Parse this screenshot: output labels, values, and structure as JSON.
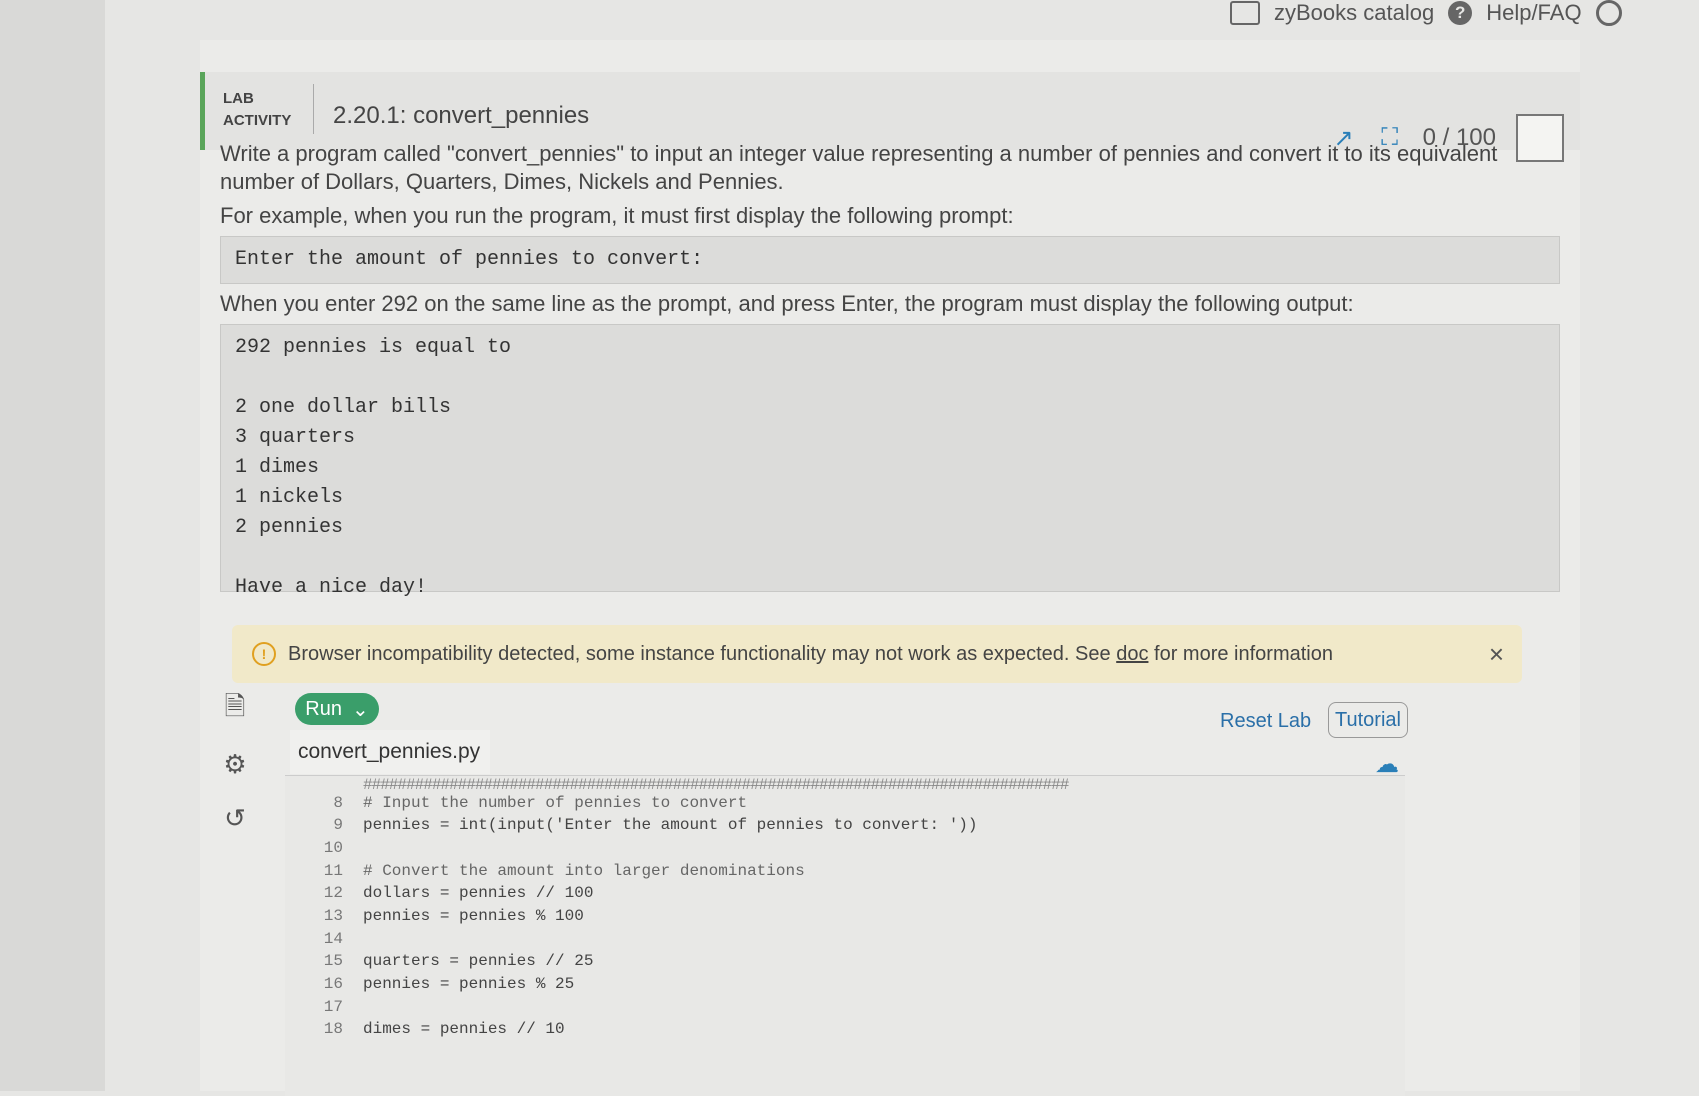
{
  "topbar": {
    "catalog": "zyBooks catalog",
    "help": "Help/FAQ"
  },
  "header": {
    "lab_line1": "LAB",
    "lab_line2": "ACTIVITY",
    "title": "2.20.1: convert_pennies",
    "score": "0 / 100"
  },
  "prompt": {
    "p1": "Write a program called \"convert_pennies\" to input an integer value representing a number of pennies and convert it to its equivalent number of Dollars, Quarters, Dimes, Nickels and Pennies.",
    "p2": "For example, when you run the program, it must first display the following prompt:",
    "prompt_code": "Enter the amount of pennies to convert:",
    "p3": "When you enter 292 on the same line as the prompt, and press Enter, the program must display the following output:",
    "output_code": "292 pennies is equal to\n\n2 one dollar bills\n3 quarters\n1 dimes\n1 nickels\n2 pennies\n\nHave a nice day!"
  },
  "warning": {
    "text": "Browser incompatibility detected, some instance functionality may not work as expected. See",
    "link": "doc",
    "tail": "for more information",
    "close": "×"
  },
  "toolbar": {
    "run": "Run",
    "reset": "Reset Lab",
    "tutorial": "Tutorial"
  },
  "file": {
    "name": "convert_pennies.py"
  },
  "code": {
    "stars": "##################################################################################",
    "lines": [
      {
        "n": "8",
        "t": "# Input the number of pennies to convert"
      },
      {
        "n": "9",
        "t": "pennies = int(input('Enter the amount of pennies to convert: '))"
      },
      {
        "n": "10",
        "t": ""
      },
      {
        "n": "11",
        "t": "# Convert the amount into larger denominations"
      },
      {
        "n": "12",
        "t": "dollars = pennies // 100"
      },
      {
        "n": "13",
        "t": "pennies = pennies % 100"
      },
      {
        "n": "14",
        "t": ""
      },
      {
        "n": "15",
        "t": "quarters = pennies // 25"
      },
      {
        "n": "16",
        "t": "pennies = pennies % 25"
      },
      {
        "n": "17",
        "t": ""
      },
      {
        "n": "18",
        "t": "dimes = pennies // 10"
      }
    ]
  }
}
